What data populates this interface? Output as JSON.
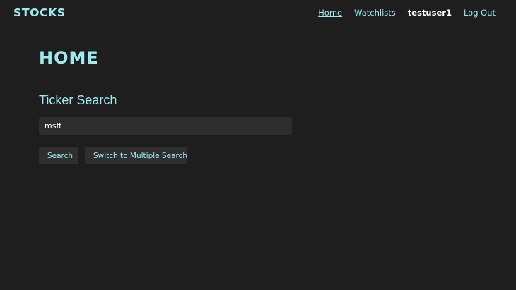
{
  "navbar": {
    "brand": "STOCKS",
    "links": {
      "home": "Home",
      "watchlists": "Watchlists",
      "user": "testuser1",
      "logout": "Log Out"
    }
  },
  "main": {
    "title": "HOME",
    "section_title": "Ticker Search",
    "search": {
      "value": "msft",
      "placeholder": ""
    },
    "buttons": {
      "search": "Search",
      "switch": "Switch to Multiple Search"
    }
  },
  "colors": {
    "background": "#1e1e1e",
    "accent": "#9eeaf0",
    "input_bg": "#2d2d2d",
    "button_bg": "#2f2f2f"
  }
}
